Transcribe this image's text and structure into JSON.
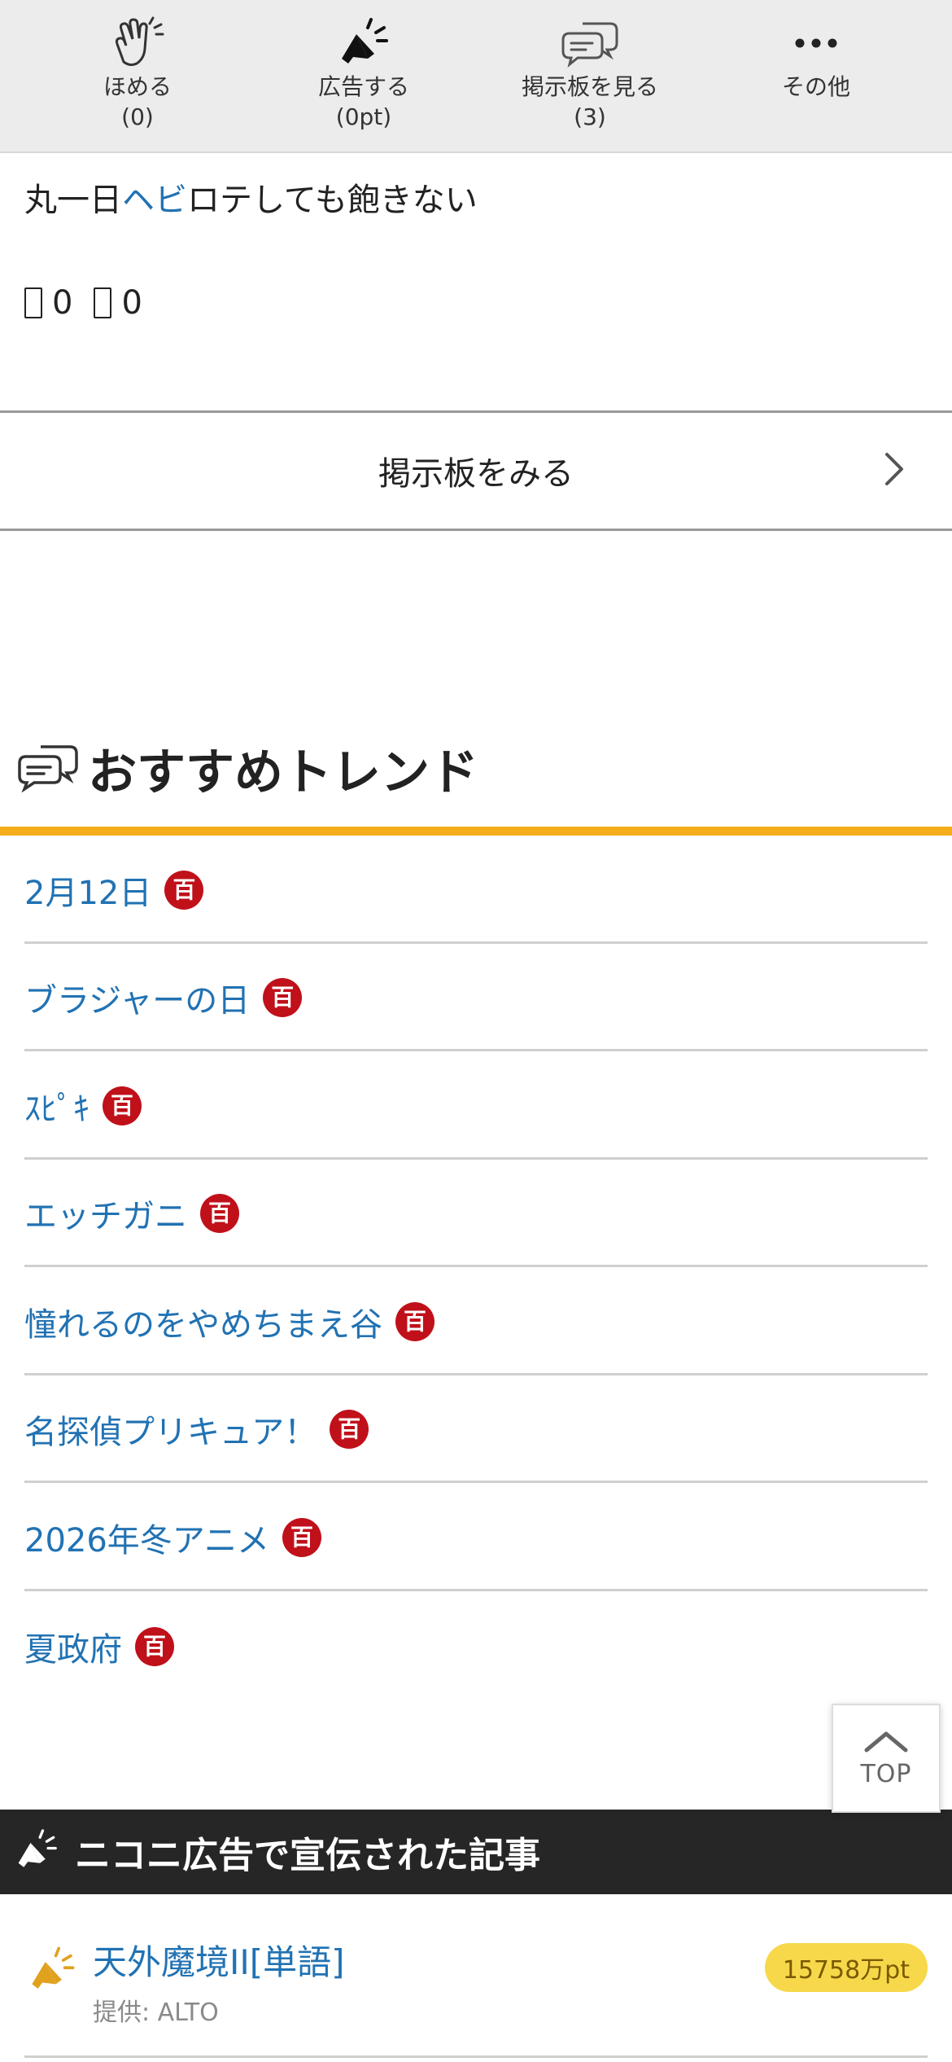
{
  "action_bar": {
    "items": [
      {
        "label": "ほめる",
        "count": "(0)",
        "icon": "clap-icon"
      },
      {
        "label": "広告する",
        "count": "(0pt)",
        "icon": "megaphone-icon"
      },
      {
        "label": "掲示板を見る",
        "count": "(3)",
        "icon": "chat-bubbles-icon"
      },
      {
        "label": "その他",
        "count": "",
        "icon": "more-dots-icon"
      }
    ]
  },
  "comment": {
    "text_before": "丸一日",
    "text_highlight": "ヘビ",
    "text_after": "ロテしても飽きない",
    "vote_up": "0",
    "vote_down": "0"
  },
  "board_link": {
    "label": "掲示板をみる"
  },
  "trends": {
    "title": "おすすめトレンド",
    "badge": "百",
    "items": [
      "2月12日",
      "ブラジャーの日",
      "ｽﾋﾟｷ",
      "エッチガニ",
      "憧れるのをやめちまえ谷",
      "名探偵プリキュア！",
      "2026年冬アニメ",
      "夏政府"
    ]
  },
  "top_button": {
    "label": "TOP"
  },
  "ad_section": {
    "title": "ニコニ広告で宣伝された記事",
    "item": {
      "title": "天外魔境II[単語]",
      "provider": "提供: ALTO",
      "points": "15758万pt"
    }
  },
  "colors": {
    "link": "#2172b3",
    "accent_orange": "#f5ad1c",
    "badge_red": "#c0101a",
    "ad_header_bg": "#262626",
    "points_badge": "#f7d84a"
  }
}
